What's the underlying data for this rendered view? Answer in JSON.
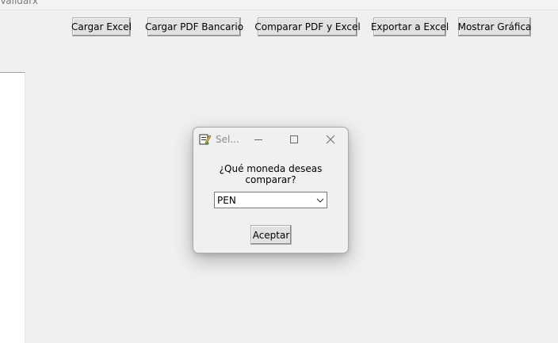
{
  "window": {
    "title_fragment": "Validarx"
  },
  "toolbar": {
    "buttons": [
      {
        "label": "Cargar Excel"
      },
      {
        "label": "Cargar PDF Bancario"
      },
      {
        "label": "Comparar PDF y Excel"
      },
      {
        "label": "Exportar a Excel"
      },
      {
        "label": "Mostrar Gráfica"
      }
    ]
  },
  "dialog": {
    "title": "Sel...",
    "icon": "app-feather-icon",
    "prompt": "¿Qué moneda deseas comparar?",
    "currency_selected": "PEN",
    "accept_label": "Aceptar",
    "caption_icons": [
      "minimize-icon",
      "maximize-icon",
      "close-icon"
    ]
  }
}
